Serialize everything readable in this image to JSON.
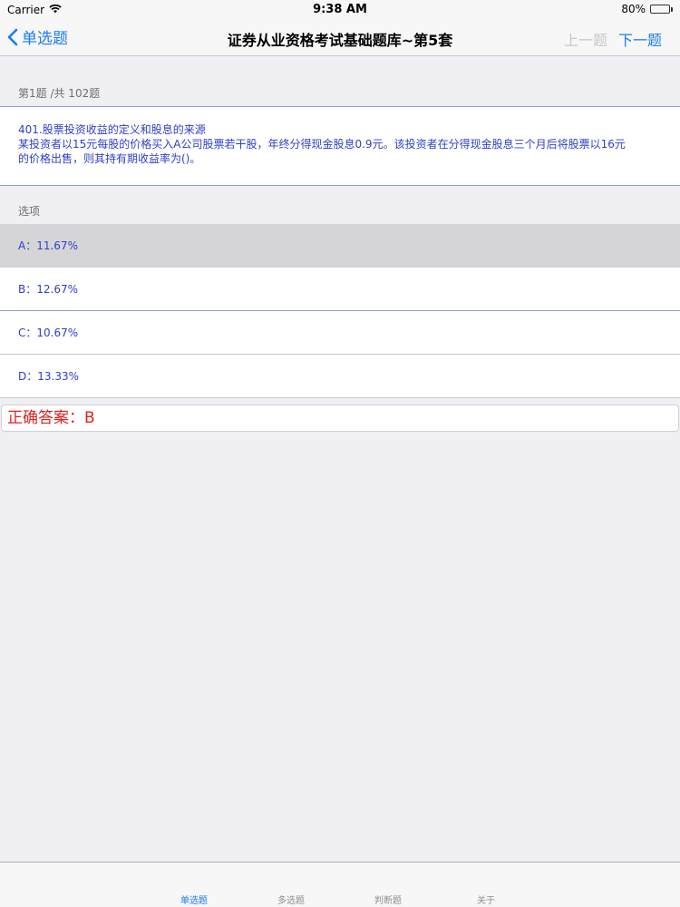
{
  "status_bar": {
    "carrier": "Carrier",
    "time": "9:38 AM",
    "battery": "80%",
    "battery_level": 0.8
  },
  "nav": {
    "back_label": "单选题",
    "title": "证券从业资格考试基础题库~第5套",
    "prev_label": "上一题",
    "next_label": "下一题"
  },
  "question": {
    "progress": "第1题 /共 102题",
    "line1": "401.股票投资收益的定义和股息的来源",
    "line2": "某投资者以15元每股的价格买入A公司股票若干股，年终分得现金股息0.9元。该投资者在分得现金股息三个月后将股票以16元",
    "line3": "的价格出售，则其持有期收益率为()。"
  },
  "options_header": "选项",
  "options": [
    {
      "label": "A：11.67%"
    },
    {
      "label": "B：12.67%"
    },
    {
      "label": "C：10.67%"
    },
    {
      "label": "D：13.33%"
    }
  ],
  "answer": "正确答案：B",
  "tabs": [
    {
      "label": "单选题"
    },
    {
      "label": "多选题"
    },
    {
      "label": "判断题"
    },
    {
      "label": "关于"
    }
  ],
  "colors": {
    "accent": "#1a7cf5",
    "question_text": "#2e3fc7",
    "answer_text": "#e02020"
  }
}
